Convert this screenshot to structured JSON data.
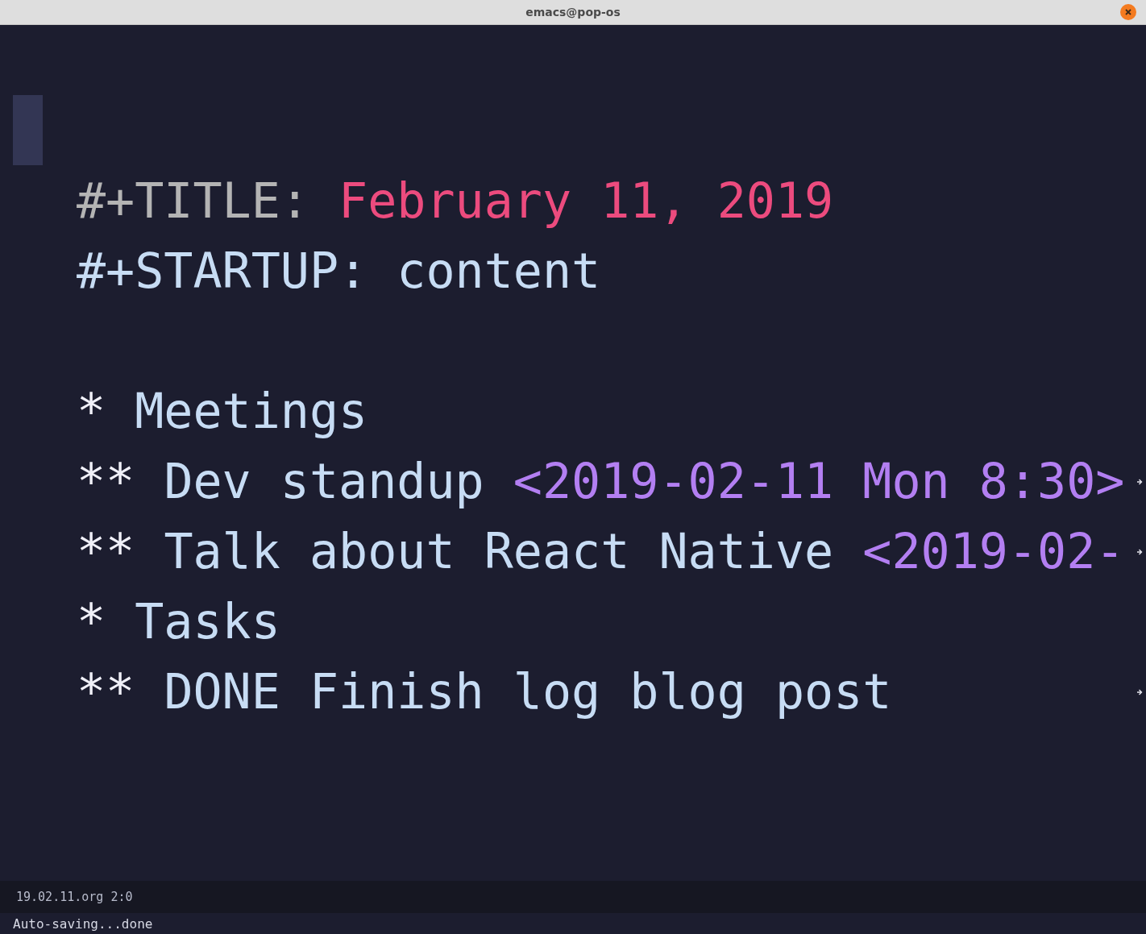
{
  "window": {
    "title": "emacs@pop-os"
  },
  "lines": [
    {
      "cursor": true,
      "truncated": false
    },
    {
      "segments": [
        {
          "kind": "keyword",
          "text": "#+TITLE: "
        },
        {
          "kind": "title",
          "text": "February 11, 2019"
        }
      ],
      "cursor": false,
      "truncated": false
    },
    {
      "segments": [
        {
          "kind": "meta",
          "text": "#+STARTUP: content"
        }
      ],
      "cursor": false,
      "truncated": false
    },
    {
      "cursor": false,
      "truncated": false
    },
    {
      "segments": [
        {
          "kind": "stars",
          "text": "* "
        },
        {
          "kind": "heading",
          "text": "Meetings"
        }
      ],
      "cursor": false,
      "truncated": false
    },
    {
      "segments": [
        {
          "kind": "stars",
          "text": "** "
        },
        {
          "kind": "heading",
          "text": "Dev standup "
        },
        {
          "kind": "timestamp",
          "text": "<2019-02-11 Mon 8:30>"
        }
      ],
      "cursor": false,
      "truncated": true
    },
    {
      "segments": [
        {
          "kind": "stars",
          "text": "** "
        },
        {
          "kind": "heading",
          "text": "Talk about React Native "
        },
        {
          "kind": "timestamp",
          "text": "<2019-02-"
        }
      ],
      "cursor": false,
      "truncated": true
    },
    {
      "segments": [
        {
          "kind": "stars",
          "text": "* "
        },
        {
          "kind": "heading",
          "text": "Tasks"
        }
      ],
      "cursor": false,
      "truncated": false
    },
    {
      "segments": [
        {
          "kind": "stars",
          "text": "** "
        },
        {
          "kind": "heading",
          "text": "DONE Finish log blog post"
        }
      ],
      "cursor": false,
      "truncated": true
    }
  ],
  "mode_line": {
    "text": "19.02.11.org 2:0"
  },
  "echo_area": {
    "text": "Auto-saving...done"
  }
}
